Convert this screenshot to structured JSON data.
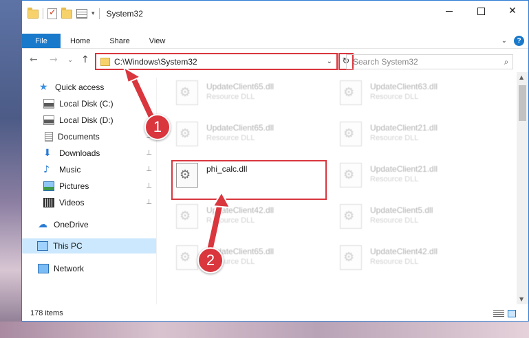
{
  "window": {
    "title": "System32",
    "controls": {
      "minimize": "",
      "maximize": "",
      "close": "✕"
    }
  },
  "quick_access_toolbar": {
    "dropdown": "▾"
  },
  "ribbon": {
    "tabs": [
      "File",
      "Home",
      "Share",
      "View"
    ],
    "expand": "⌄",
    "help": "?"
  },
  "nav": {
    "back": "←",
    "forward": "→",
    "recent": "⌄",
    "up": "↑"
  },
  "address": {
    "path": "C:\\Windows\\System32",
    "dropdown": "⌄",
    "refresh": "↻"
  },
  "search": {
    "placeholder": "Search System32",
    "icon": "⌕"
  },
  "sidebar": {
    "items": [
      {
        "label": "Quick access",
        "icon": "star-icon"
      },
      {
        "label": "Local Disk (C:)",
        "icon": "drive-icon"
      },
      {
        "label": "Local Disk (D:)",
        "icon": "drive-icon"
      },
      {
        "label": "Documents",
        "icon": "documents-icon",
        "pinned": true
      },
      {
        "label": "Downloads",
        "icon": "download-icon",
        "pinned": true
      },
      {
        "label": "Music",
        "icon": "music-icon",
        "pinned": true
      },
      {
        "label": "Pictures",
        "icon": "pictures-icon",
        "pinned": true
      },
      {
        "label": "Videos",
        "icon": "videos-icon",
        "pinned": true
      },
      {
        "label": "OneDrive",
        "icon": "cloud-icon"
      },
      {
        "label": "This PC",
        "icon": "pc-icon",
        "selected": true
      },
      {
        "label": "Network",
        "icon": "network-icon"
      }
    ],
    "pin_glyph": "📌"
  },
  "files": [
    {
      "name": "UpdateClient65.dll",
      "desc": "Resource DLL"
    },
    {
      "name": "UpdateClient63.dll",
      "desc": "Resource DLL"
    },
    {
      "name": "UpdateClient65.dll",
      "desc": "Resource DLL"
    },
    {
      "name": "UpdateClient21.dll",
      "desc": "Resource DLL"
    },
    {
      "name": "phi_calc.dll",
      "desc": ""
    },
    {
      "name": "UpdateClient21.dll",
      "desc": "Resource DLL"
    },
    {
      "name": "UpdateClient42.dll",
      "desc": "Resource DLL"
    },
    {
      "name": "UpdateClient5.dll",
      "desc": "Resource DLL"
    },
    {
      "name": "UpdateClient65.dll",
      "desc": "Resource DLL"
    },
    {
      "name": "UpdateClient42.dll",
      "desc": "Resource DLL"
    }
  ],
  "status": {
    "item_count": "178 items"
  },
  "scrollbar": {
    "up": "▲",
    "down": "▼"
  },
  "annotations": {
    "step1": "1",
    "step2": "2",
    "color": "#d9363e"
  }
}
